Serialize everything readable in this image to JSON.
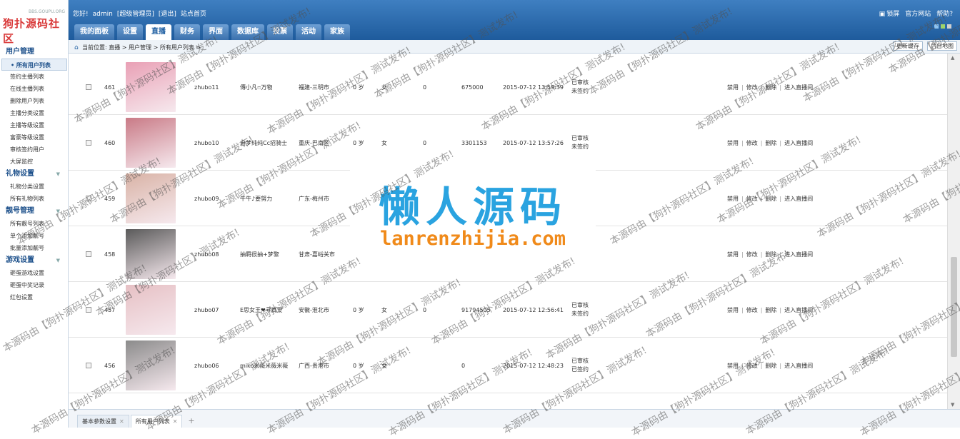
{
  "logo": {
    "sub": "BBS.GOUPU.ORG",
    "text": "狗扑源码社区"
  },
  "topbar": {
    "welcome": "您好!",
    "user": "admin",
    "role": "[超级管理员]",
    "logout": "[退出]",
    "site_home": "站点首页",
    "lock": "锁屏",
    "official": "官方网站",
    "help": "帮助?",
    "tabs": [
      "我的面板",
      "设置",
      "直播",
      "财务",
      "界面",
      "数据库",
      "投票",
      "活动",
      "家族"
    ],
    "active_tab": 2
  },
  "breadcrumb": {
    "text": "当前位置: 直播 > 用户管理 > 所有用户列表 >",
    "update_cache": "更新缓存",
    "backend_map": "后台地图"
  },
  "sidebar": {
    "groups": [
      {
        "title": "用户管理",
        "items": [
          "所有用户列表",
          "签约主播列表",
          "在线主播列表",
          "删除用户列表",
          "主播分类设置",
          "主播等级设置",
          "富豪等级设置",
          "审核签约用户",
          "大屏监控"
        ]
      },
      {
        "title": "礼物设置",
        "items": [
          "礼物分类设置",
          "所有礼物列表"
        ]
      },
      {
        "title": "靓号管理",
        "items": [
          "所有靓号列表",
          "单个添加靓号",
          "批量添加靓号"
        ]
      },
      {
        "title": "游戏设置",
        "items": [
          "砸蛋游戏设置",
          "砸蛋中奖记录",
          "红包设置"
        ]
      }
    ]
  },
  "rows": [
    {
      "id": "461",
      "username": "zhubo11",
      "nickname": "傳小凡ෆ万物",
      "location": "福建-三明市",
      "age": "0 岁",
      "gender": "女",
      "coins": "0",
      "score": "675000",
      "time": "2015-07-12 13:59:39",
      "status1": "已审核",
      "status2": "未签约",
      "avatar_color": "#e9a0b5"
    },
    {
      "id": "460",
      "username": "zhubo10",
      "nickname": "启梦纯纯Cc招骑士",
      "location": "重庆-巴南区",
      "age": "0 岁",
      "gender": "女",
      "coins": "0",
      "score": "3301153",
      "time": "2015-07-12 13:57:26",
      "status1": "已审核",
      "status2": "未签约",
      "avatar_color": "#c97a86"
    },
    {
      "id": "459",
      "username": "zhubo09",
      "nickname": "牛牛♪要努力",
      "location": "广东-梅州市",
      "age": "",
      "gender": "",
      "coins": "",
      "score": "",
      "time": "",
      "status1": "",
      "status2": "",
      "avatar_color": "#d9b3a6"
    },
    {
      "id": "458",
      "username": "zhubo08",
      "nickname": "抽羁很抽+梦黎",
      "location": "甘肃-嘉峪关市",
      "age": "",
      "gender": "女",
      "coins": "",
      "score": "",
      "time": "",
      "status1": "",
      "status2": "未签约",
      "avatar_color": "#5a5a5a"
    },
    {
      "id": "457",
      "username": "zhubo07",
      "nickname": "E思女王❤寻真爱",
      "location": "安徽-淮北市",
      "age": "0 岁",
      "gender": "女",
      "coins": "0",
      "score": "91794505",
      "time": "2015-07-12 12:56:41",
      "status1": "已审核",
      "status2": "未签约",
      "avatar_color": "#e6c0c4"
    },
    {
      "id": "456",
      "username": "zhubo06",
      "nickname": "miko米薇米薇米薇",
      "location": "广西-贵港市",
      "age": "0 岁",
      "gender": "女",
      "coins": "",
      "score": "0",
      "time": "2015-07-12 12:48:23",
      "status1": "已审核",
      "status2": "已签约",
      "avatar_color": "#8b8b8b"
    }
  ],
  "actions": {
    "ban": "禁用",
    "edit": "修改",
    "delete": "删除",
    "enter": "进入直播间",
    "sep": "|"
  },
  "bottom_tabs": [
    "基本参数设置",
    "所有用户列表"
  ],
  "overlay": {
    "title": "懒人源码",
    "url": "lanrenzhijia.com"
  },
  "watermark": {
    "text": "本源码由【狗扑源码社区】测试发布!"
  }
}
